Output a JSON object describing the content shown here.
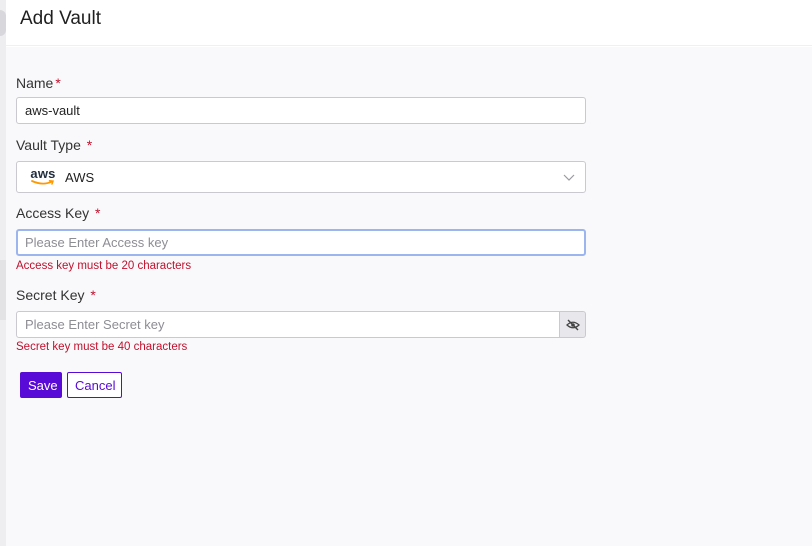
{
  "header": {
    "title": "Add Vault"
  },
  "form": {
    "name": {
      "label": "Name",
      "required": "*",
      "value": "aws-vault"
    },
    "vault_type": {
      "label": "Vault Type",
      "required": "*",
      "logo_text": "aws",
      "selected": "AWS",
      "icon": "chevron-down-icon"
    },
    "access_key": {
      "label": "Access Key",
      "required": "*",
      "value": "",
      "placeholder": "Please Enter Access key",
      "error": "Access key must be 20 characters"
    },
    "secret_key": {
      "label": "Secret Key",
      "required": "*",
      "value": "",
      "placeholder": "Please Enter Secret key",
      "error": "Secret key must be 40 characters",
      "toggle_icon": "eye-slash-icon"
    }
  },
  "actions": {
    "save": "Save",
    "cancel": "Cancel"
  },
  "colors": {
    "primary": "#5a0ad6",
    "error": "#c0112d",
    "focus": "#9db5ee",
    "aws_orange": "#ff9900"
  }
}
